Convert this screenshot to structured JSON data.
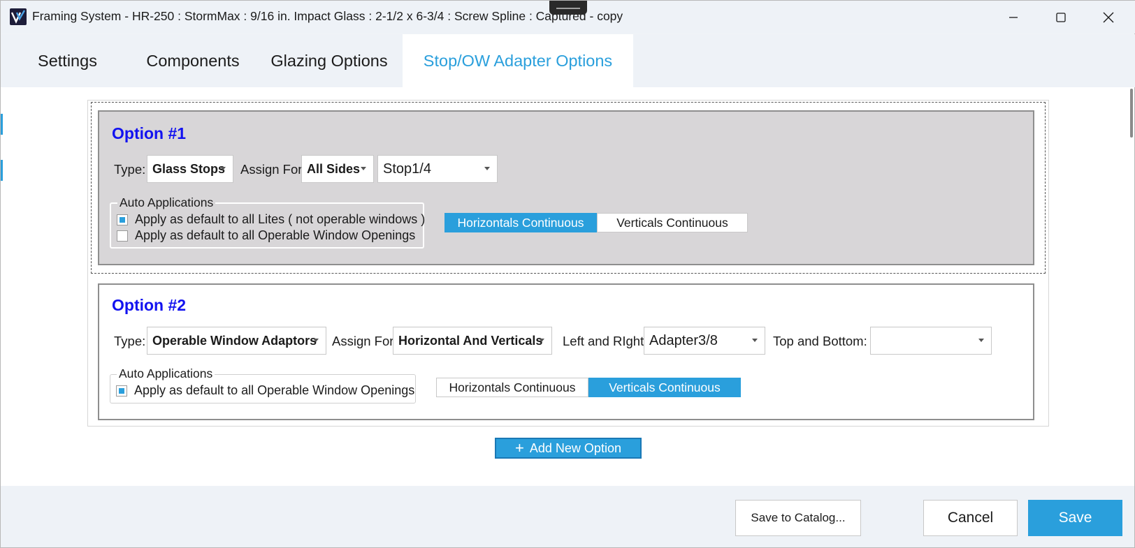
{
  "window": {
    "title": "Framing System - HR-250 : StormMax : 9/16 in. Impact Glass : 2-1/2 x 6-3/4 : Screw Spline : Captured - copy",
    "controls": {
      "minimize": "minimize-icon",
      "maximize": "maximize-icon",
      "close": "close-icon"
    }
  },
  "tabs": [
    {
      "label": "Settings",
      "active": false
    },
    {
      "label": "Components",
      "active": false
    },
    {
      "label": "Glazing Options",
      "active": false
    },
    {
      "label": "Stop/OW Adapter Options",
      "active": true
    }
  ],
  "option1": {
    "title": "Option #1",
    "type_label": "Type:",
    "type_value": "Glass Stops",
    "assign_label": "Assign For",
    "assign_value": "All Sides",
    "part_value": "Stop1/4",
    "auto_legend": "Auto Applications",
    "check1_label": "Apply as default to all Lites ( not operable windows )",
    "check1_checked": true,
    "check2_label": "Apply as default to all Operable Window Openings",
    "check2_checked": false,
    "seg_horizontal": "Horizontals Continuous",
    "seg_vertical": "Verticals Continuous",
    "selected_segment": "Horizontals Continuous"
  },
  "option2": {
    "title": "Option #2",
    "type_label": "Type:",
    "type_value": "Operable Window Adaptors",
    "assign_label": "Assign For",
    "assign_value": "Horizontal And Verticals",
    "lr_label": "Left and RIght:",
    "lr_value": "Adapter3/8",
    "tb_label": "Top and Bottom:",
    "tb_value": "",
    "auto_legend": "Auto Applications",
    "check1_label": "Apply as default to all Operable Window Openings",
    "check1_checked": true,
    "seg_horizontal": "Horizontals Continuous",
    "seg_vertical": "Verticals Continuous",
    "selected_segment": "Verticals Continuous"
  },
  "add_option_label": "Add New Option",
  "footer": {
    "save_catalog": "Save to Catalog...",
    "cancel": "Cancel",
    "save": "Save"
  },
  "colors": {
    "accent": "#2a9fdc",
    "option_title": "#1212f0",
    "selected_option_bg": "#d8d6d8"
  }
}
